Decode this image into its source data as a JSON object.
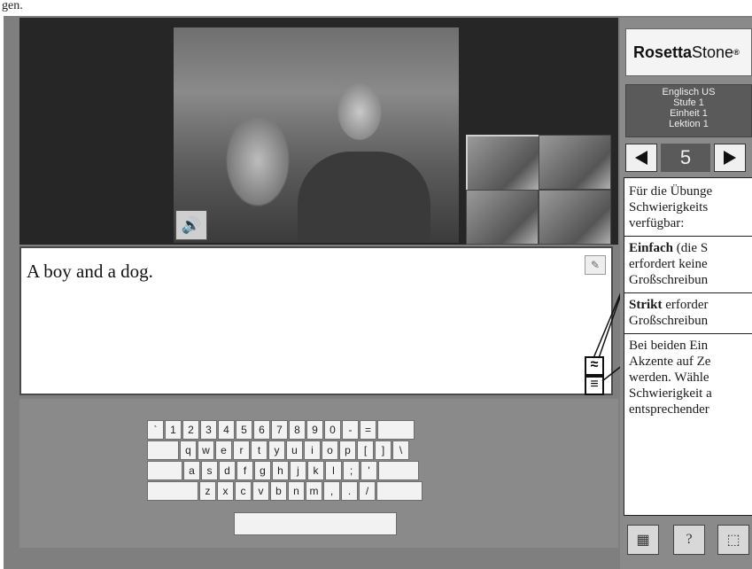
{
  "page": {
    "title_fragment": "gen."
  },
  "lesson": {
    "answer_text": "A boy and a dog.",
    "speaker_icon": "speaker-icon",
    "hint_icon": "hint-icon"
  },
  "sidebar": {
    "brand_bold": "Rosetta",
    "brand_rest": "Stone",
    "brand_mark": "®",
    "language": "Englisch US",
    "level": "Stufe 1",
    "unit": "Einheit 1",
    "lesson": "Lektion 1",
    "page_number": "5",
    "prev_icon": "triangle-left-icon",
    "next_icon": "triangle-right-icon"
  },
  "keyboard": {
    "row1": [
      "`",
      "1",
      "2",
      "3",
      "4",
      "5",
      "6",
      "7",
      "8",
      "9",
      "0",
      "-",
      "=",
      ""
    ],
    "row2": [
      "",
      "q",
      "w",
      "e",
      "r",
      "t",
      "y",
      "u",
      "i",
      "o",
      "p",
      "[",
      "]",
      "\\"
    ],
    "row3": [
      "",
      "a",
      "s",
      "d",
      "f",
      "g",
      "h",
      "j",
      "k",
      "l",
      ";",
      "'",
      ""
    ],
    "row4": [
      "",
      "z",
      "x",
      "c",
      "v",
      "b",
      "n",
      "m",
      ",",
      ".",
      "/",
      ""
    ]
  },
  "callout": {
    "l1": "Für die Übunge",
    "l2": "Schwierigkeits",
    "l3": "verfügbar:",
    "easy_bold": "Einfach",
    "easy_rest": " (die S",
    "l5": "erfordert keine",
    "l6": "Großschreibun",
    "strict_bold": "Strikt",
    "strict_rest": " erforder",
    "l8": "Großschreibun",
    "l9": "Bei beiden Ein",
    "l10": "Akzente auf Ze",
    "l11": "werden. Wähle",
    "l12": "Schwierigkeit a",
    "l13": "entsprechender"
  },
  "bottom_buttons": {
    "b1_icon": "settings-icon",
    "b2_label": "?",
    "b3_icon": "tutor-icon"
  }
}
